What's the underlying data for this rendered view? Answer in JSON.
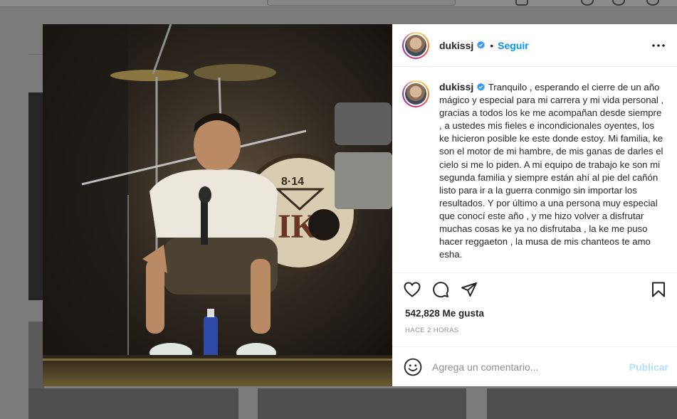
{
  "post": {
    "username": "dukissj",
    "follow_label": "Seguir",
    "separator": "•",
    "caption_username": "dukissj",
    "caption_text": "Tranquilo , esperando el cierre de un año mágico y especial para mi carrera y mi vida personal , gracias a todos los ke me acompañan desde siempre , a ustedes mis fieles e incondicionales oyentes, los ke hicieron posible ke este donde estoy. Mi familia, ke son el motor de mi hambre, de mis ganas de darles el cielo si me lo piden. A mi equipo de trabajo ke son mi segunda familia y siempre están ahí al pie del cañón listo para ir a la guerra conmigo sin importar los resultados. Y por último a una persona muy especial que conocí este año , y me hizo volver a disfrutar muchas cosas ke ya no disfrutaba , la ke me puso hacer reggaeton , la musa de mis chanteos te amo esha.",
    "likes": "542,828 Me gusta",
    "timestamp": "HACE 2 HORAS",
    "photo_banner_text": "8·14"
  },
  "comment": {
    "placeholder": "Agrega un comentario...",
    "publish_label": "Publicar"
  },
  "icons": {
    "verified": "verified-badge-icon",
    "more": "more-options-icon",
    "like": "heart-icon",
    "comment": "comment-icon",
    "share": "send-icon",
    "save": "bookmark-icon",
    "emoji": "emoji-icon"
  },
  "colors": {
    "accent": "#0095f6",
    "publish_disabled": "#b2dffc",
    "text": "#262626",
    "muted": "#8e8e8e"
  }
}
